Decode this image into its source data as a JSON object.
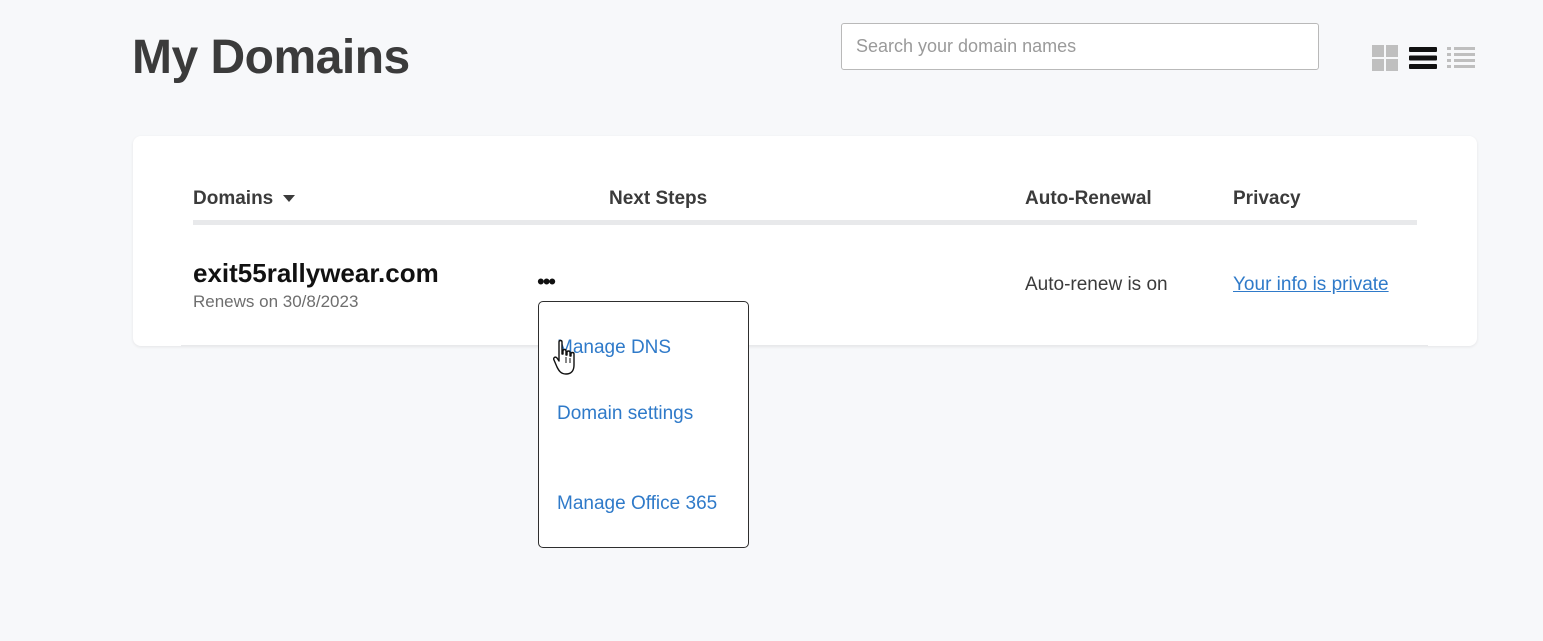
{
  "header": {
    "title": "My Domains",
    "search_placeholder": "Search your domain names"
  },
  "view_toggles": [
    {
      "icon": "grid-view-icon",
      "active": false
    },
    {
      "icon": "list-view-icon",
      "active": true
    },
    {
      "icon": "compact-list-view-icon",
      "active": false
    }
  ],
  "table": {
    "columns": {
      "domains": "Domains",
      "next_steps": "Next Steps",
      "auto_renewal": "Auto-Renewal",
      "privacy": "Privacy"
    },
    "rows": [
      {
        "domain": "exit55rallywear.com",
        "renews": "Renews on 30/8/2023",
        "more_label": "•••",
        "auto_renewal": "Auto-renew is on",
        "privacy": "Your info is private"
      }
    ]
  },
  "next_steps_menu": {
    "items": [
      "Manage DNS",
      "Domain settings",
      "Manage Office 365"
    ]
  },
  "colors": {
    "link": "#2f7ac9",
    "background": "#f7f8fa",
    "active_toggle": "#111111",
    "inactive_toggle": "#bfbfbf"
  }
}
